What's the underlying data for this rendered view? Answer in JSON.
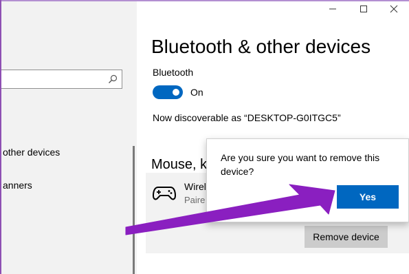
{
  "window": {
    "controls": {
      "minimize": "minimize",
      "maximize": "maximize",
      "close": "close"
    }
  },
  "sidebar": {
    "search": {
      "placeholder": ""
    },
    "items": [
      {
        "label": "other devices"
      },
      {
        "label": "anners"
      }
    ]
  },
  "main": {
    "title": "Bluetooth & other devices",
    "bluetooth_label": "Bluetooth",
    "toggle_state": "On",
    "discoverable_text": "Now discoverable as “DESKTOP-G0ITGC5”",
    "section_heading": "Mouse, k",
    "device": {
      "name": "Wirel",
      "status": "Paire",
      "icon": "gamepad-icon",
      "remove_label": "Remove device"
    }
  },
  "dialog": {
    "question": "Are you sure you want to remove this device?",
    "yes_label": "Yes"
  },
  "colors": {
    "accent": "#0067c0",
    "annotation_arrow": "#8a1fc0",
    "sidebar_bg": "#f2f2f2",
    "button_gray": "#cccccc"
  }
}
